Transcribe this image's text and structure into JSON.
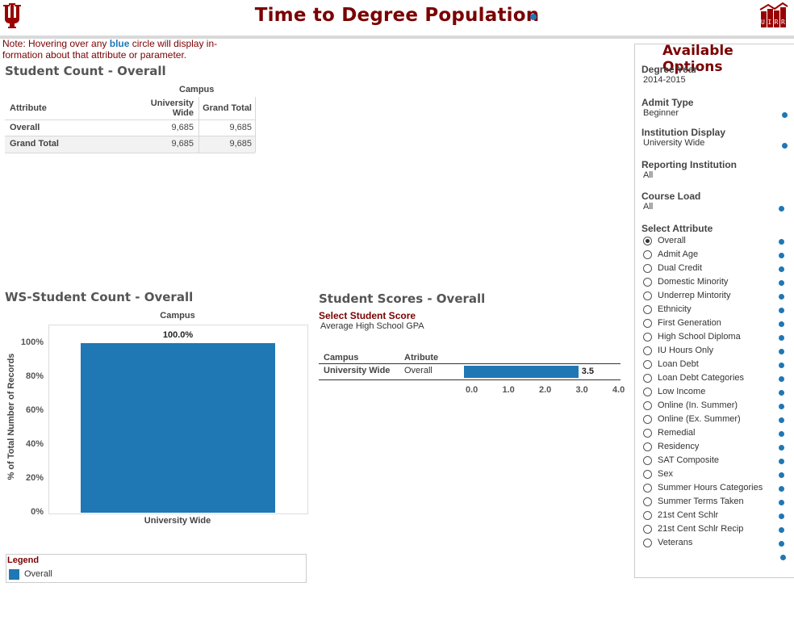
{
  "header": {
    "title": "Time to Degree Population",
    "uirr_logo_text": "UIRR"
  },
  "note": {
    "prefix": "Note: Hovering over any",
    "blue_word": "blue",
    "suffix": "circle will display in-formation about that attribute or parameter."
  },
  "student_count": {
    "title": "Student Count - Overall",
    "campus_header": "Campus",
    "columns": [
      "Attribute",
      "University Wide",
      "Grand Total"
    ],
    "rows": [
      {
        "label": "Overall",
        "university_wide": "9,685",
        "grand_total": "9,685"
      },
      {
        "label": "Grand Total",
        "university_wide": "9,685",
        "grand_total": "9,685"
      }
    ]
  },
  "ws_chart": {
    "title": "WS-Student Count - Overall",
    "campus_header": "Campus",
    "y_axis_label": "% of Total Number of Records"
  },
  "chart_data": {
    "type": "bar",
    "categories": [
      "University Wide"
    ],
    "values": [
      100.0
    ],
    "data_labels": [
      "100.0%"
    ],
    "y_ticks": [
      "100%",
      "80%",
      "60%",
      "40%",
      "20%",
      "0%"
    ],
    "ylim": [
      0,
      100
    ],
    "ylabel": "% of Total Number of Records",
    "xlabel": "",
    "bar_color": "#1f77b4"
  },
  "legend": {
    "title": "Legend",
    "items": [
      {
        "label": "Overall",
        "color": "#1f77b4"
      }
    ]
  },
  "scores": {
    "title": "Student Scores - Overall",
    "select_label": "Select Student Score",
    "selected_score": "Average High School GPA",
    "col_campus": "Campus",
    "col_attribute": "Atribute",
    "row_campus": "University Wide",
    "row_attribute": "Overall",
    "value": 3.5,
    "value_label": "3.5",
    "axis_ticks": [
      "0.0",
      "1.0",
      "2.0",
      "3.0",
      "4.0"
    ],
    "axis_max": 4.0
  },
  "options": {
    "title": "Available Options",
    "degree_year_label": "Degree Year",
    "degree_year_value": "2014-2015",
    "admit_type_label": "Admit Type",
    "admit_type_value": "Beginner",
    "institution_display_label": "Institution Display",
    "institution_display_value": "University Wide",
    "reporting_institution_label": "Reporting Institution",
    "reporting_institution_value": "All",
    "course_load_label": "Course Load",
    "course_load_value": "All",
    "select_attribute_label": "Select Attribute",
    "attributes": [
      "Overall",
      "Admit Age",
      "Dual Credit",
      "Domestic Minority",
      "Underrep Mintority",
      "Ethnicity",
      "First Generation",
      "High School Diploma",
      "IU Hours Only",
      "Loan Debt",
      "Loan Debt Categories",
      "Low Income",
      "Online (In. Summer)",
      "Online (Ex. Summer)",
      "Remedial",
      "Residency",
      "SAT Composite",
      "Sex",
      "Summer Hours Categories",
      "Summer Terms Taken",
      "21st Cent Schlr",
      "21st Cent Schlr Recip",
      "Veterans"
    ],
    "selected_attribute": "Overall"
  },
  "colors": {
    "brand_crimson": "#7a0000",
    "info_blue": "#1f77b4"
  }
}
